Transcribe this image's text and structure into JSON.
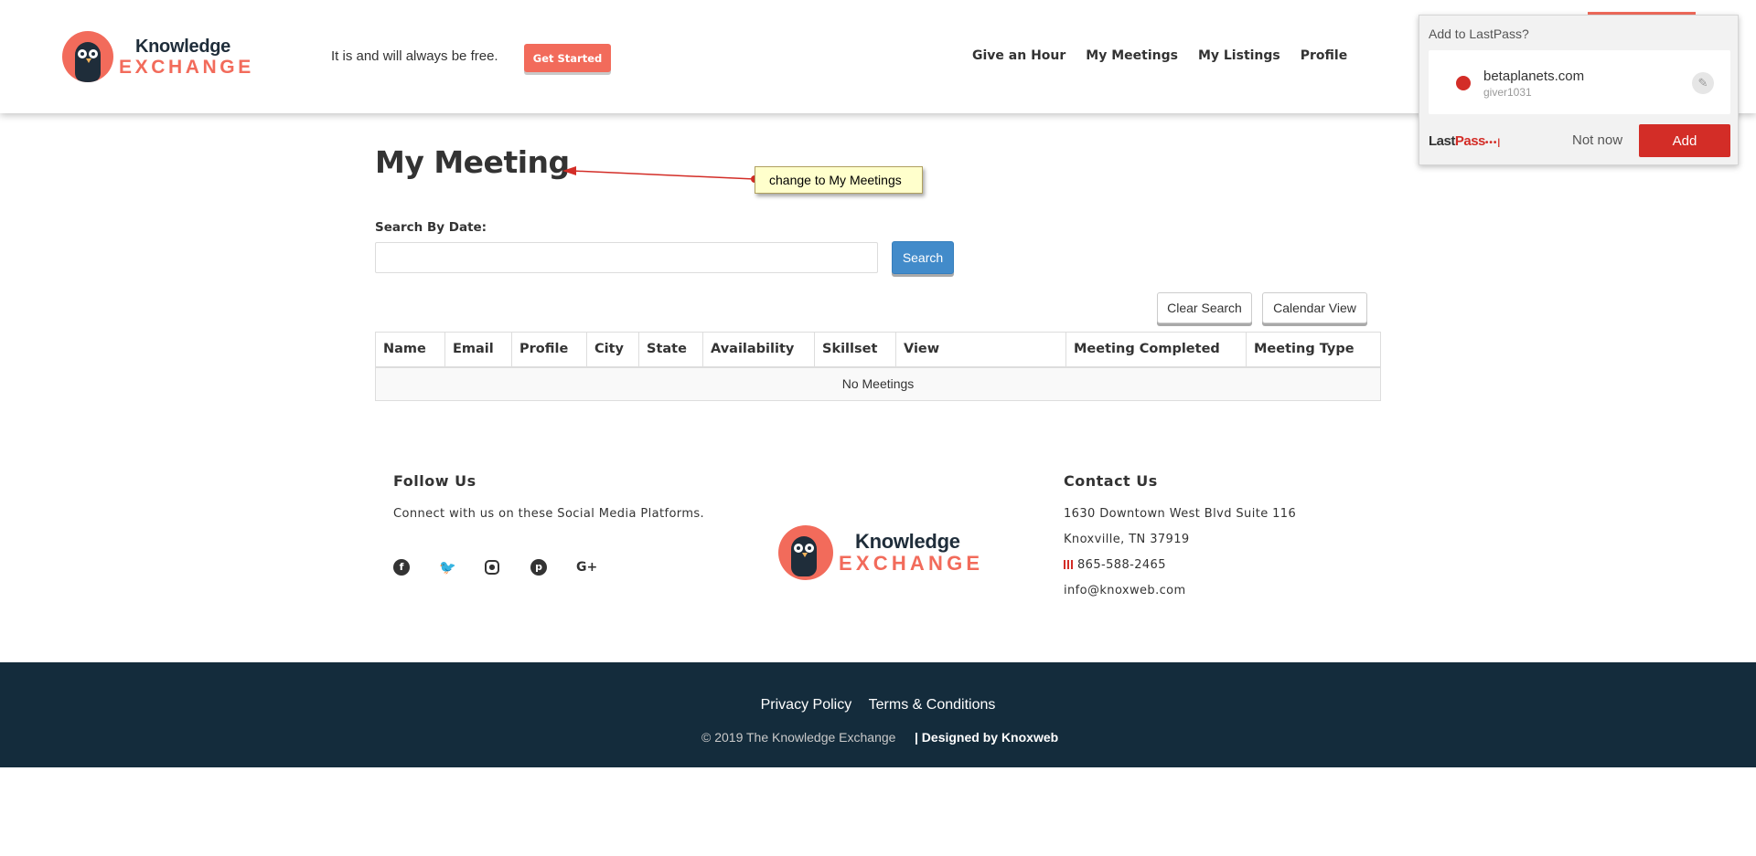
{
  "header": {
    "logo_knowledge": "Knowledge",
    "logo_exchange": "EXCHANGE",
    "tagline": "It is and will always be free.",
    "get_started": "Get Started",
    "nav": [
      "Give an Hour",
      "My Meetings",
      "My Listings",
      "Profile"
    ]
  },
  "lastpass": {
    "question": "Add to LastPass?",
    "site": "betaplanets.com",
    "username": "giver1031",
    "brand_last": "Last",
    "brand_pass": "Pass",
    "brand_dots": "•••|",
    "not_now": "Not now",
    "add": "Add"
  },
  "main": {
    "title": "My Meeting",
    "annotation": "change to My Meetings",
    "search_label": "Search By Date:",
    "search_value": "",
    "search_button": "Search",
    "clear_button": "Clear Search",
    "calendar_button": "Calendar View",
    "table": {
      "columns": [
        "Name",
        "Email",
        "Profile",
        "City",
        "State",
        "Availability",
        "Skillset",
        "View",
        "Meeting Completed",
        "Meeting Type"
      ],
      "empty_message": "No Meetings"
    }
  },
  "footer": {
    "follow_title": "Follow Us",
    "follow_text": "Connect with us on these Social Media Platforms.",
    "social": [
      "facebook",
      "twitter",
      "instagram",
      "pinterest",
      "google-plus"
    ],
    "contact_title": "Contact Us",
    "address1": "1630 Downtown West Blvd Suite 116",
    "address2": "Knoxville, TN 37919",
    "phone": "865-588-2465",
    "email": "info@knoxweb.com",
    "privacy": "Privacy Policy",
    "terms": "Terms & Conditions",
    "copyright": "© 2019 The Knowledge Exchange",
    "designed": "| Designed by Knoxweb"
  },
  "colors": {
    "brand": "#f26b5b",
    "dark": "#1f2d3a",
    "footer_bg": "#142c3c",
    "lastpass_red": "#d32d27",
    "search_blue": "#428bca",
    "annotation_bg": "#ffffcc"
  }
}
